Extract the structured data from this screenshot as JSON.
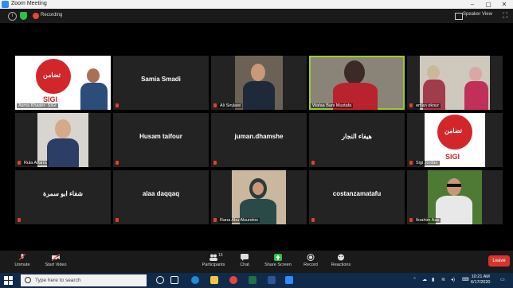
{
  "window": {
    "title": "Zoom Meeting"
  },
  "topbar": {
    "recording_label": "Recording",
    "speaker_view_label": "Speaker View"
  },
  "tiles": [
    {
      "label": "Asma Khader- SIGI"
    },
    {
      "center_name": "Samia Smadi"
    },
    {
      "label": "Ali Sinjlawi"
    },
    {
      "label": "Wafaa Bani Mustafa"
    },
    {
      "label": "eman okour"
    },
    {
      "label": "Rula Alfarra"
    },
    {
      "center_name": "Husam taifour"
    },
    {
      "center_name": "juman.dhamshe"
    },
    {
      "center_name": "هيفاء النجار"
    },
    {
      "label": "Sigi Jordan"
    },
    {
      "center_name": "شفاء ابو سمرة"
    },
    {
      "center_name": "alaa daqqaq"
    },
    {
      "label": "Rana Abu Alsundos"
    },
    {
      "center_name": "costanzamatafu"
    },
    {
      "label": "Ibrahim Aza"
    }
  ],
  "logo": {
    "arabic": "تضامن",
    "latin": "SIGI"
  },
  "controls": {
    "unmute": "Unmute",
    "start_video": "Start Video",
    "participants": "Participants",
    "participants_count": "15",
    "chat": "Chat",
    "share_screen": "Share Screen",
    "record": "Record",
    "reactions": "Reactions",
    "leave": "Leave"
  },
  "taskbar": {
    "search_placeholder": "Type here to search",
    "time": "10:21 AM",
    "date": "6/17/2020"
  },
  "colors": {
    "leave": "#d8342e",
    "share": "#2fbf4a",
    "active_border": "#9ccc2b",
    "logo_red": "#d2262b"
  }
}
